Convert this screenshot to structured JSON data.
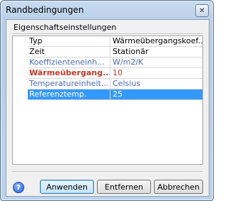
{
  "window": {
    "title": "Randbedingungen",
    "close_glyph": "✕"
  },
  "group": {
    "label": "Eigenschaftseinstellungen"
  },
  "properties": [
    {
      "name": "Typ",
      "value": "Wärmeübergangskoef...",
      "style": "normal"
    },
    {
      "name": "Zeit",
      "value": "Stationär",
      "style": "normal"
    },
    {
      "name": "Koeffizienteneinh...",
      "value": "W/m2/K",
      "style": "blue"
    },
    {
      "name": "Wärmeübergang...",
      "value": "10",
      "style": "red-bold"
    },
    {
      "name": "Temperatureinheit...",
      "value": "Celsius",
      "style": "blue"
    },
    {
      "name": "Referenztemp.",
      "value": "25",
      "style": "selected"
    }
  ],
  "buttons": {
    "help_glyph": "?",
    "apply": "Anwenden",
    "remove": "Entfernen",
    "cancel": "Abbrechen"
  },
  "colors": {
    "selection": "#3399ff",
    "blue_text": "#4a6ab8",
    "red_text": "#c0392b"
  },
  "icons": {
    "close": "close-icon",
    "help": "help-icon"
  }
}
